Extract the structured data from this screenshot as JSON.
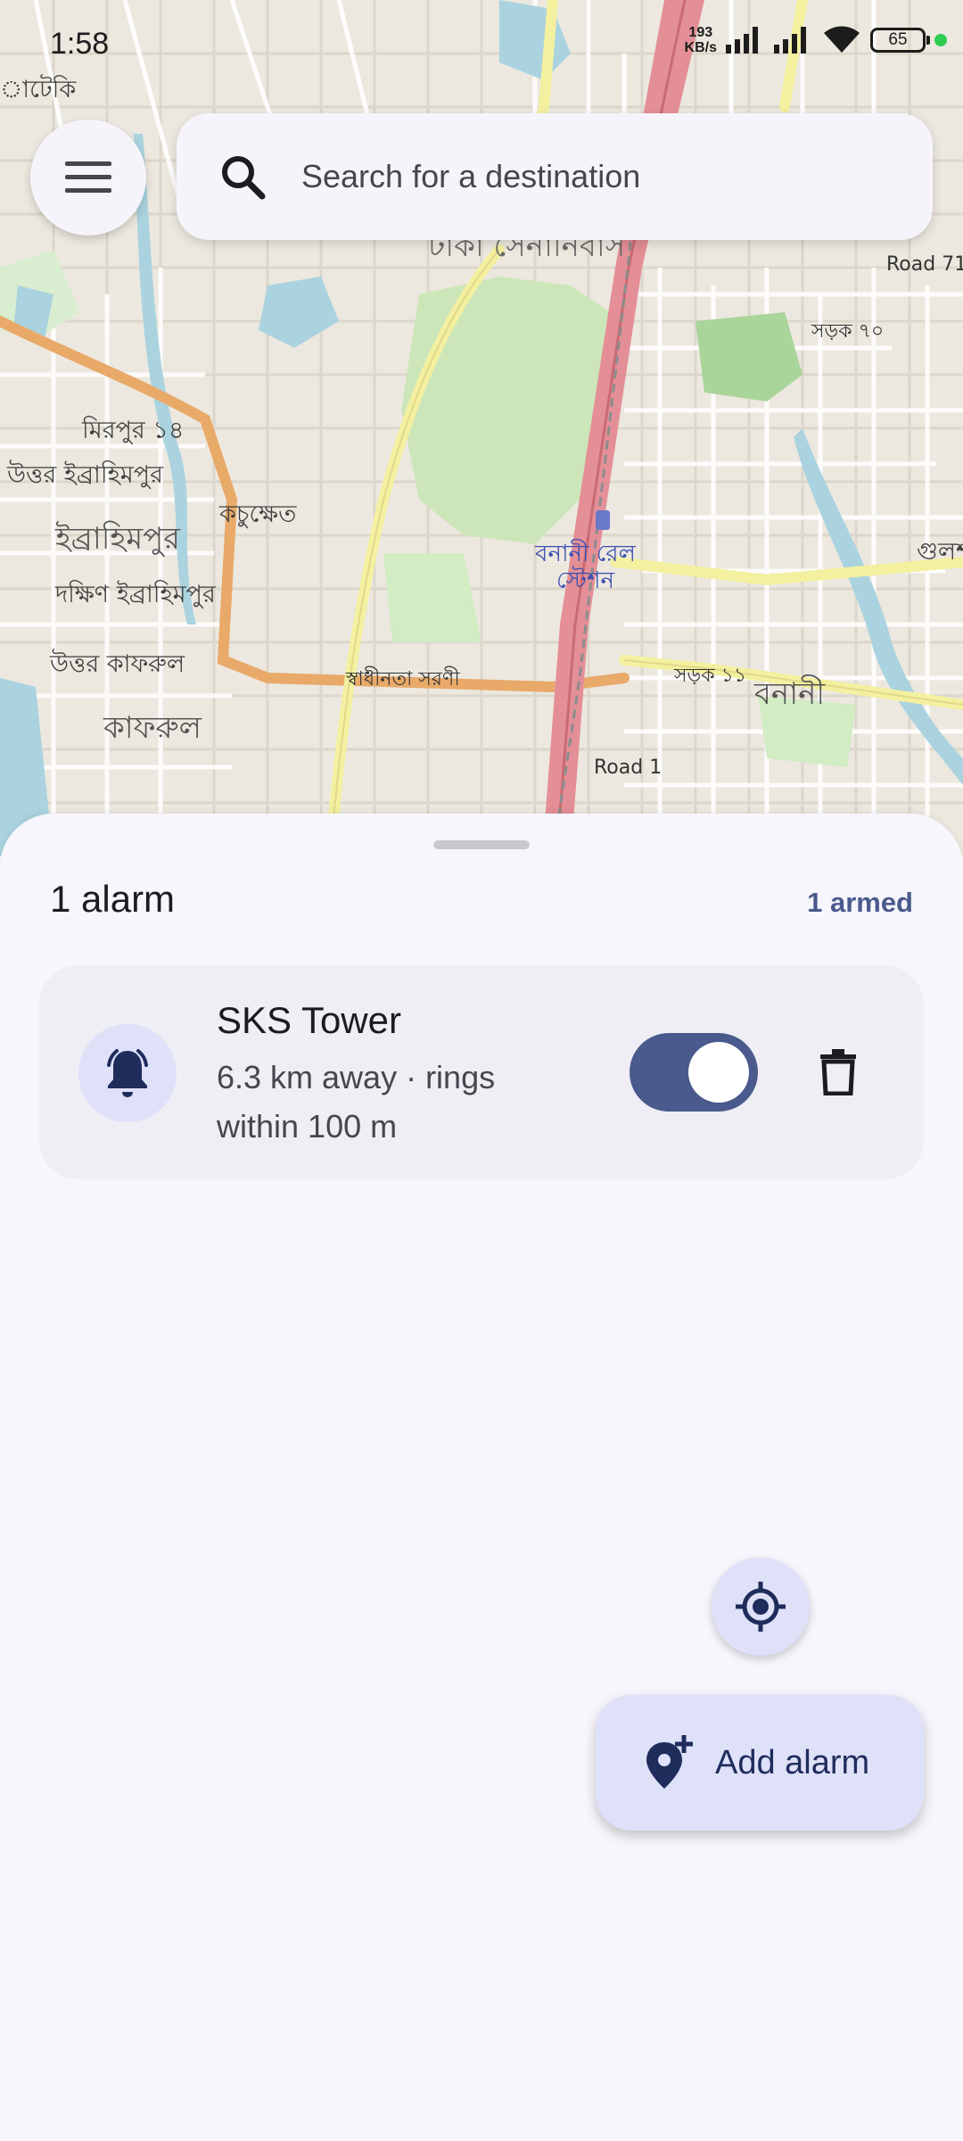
{
  "status_bar": {
    "time": "1:58",
    "net_speed_value": "193",
    "net_speed_unit": "KB/s",
    "battery": "65",
    "icons": [
      "signal-icon",
      "signal-icon",
      "wifi-icon",
      "battery-icon",
      "privacy-dot"
    ]
  },
  "map": {
    "labels": {
      "top_left": "াটেকি",
      "mirpur": "মিরপুর ১৪",
      "uttar_ibrahimpur": "উত্তর ইব্রাহিমপুর",
      "ibrahimpur": "ইব্রাহিমপুর",
      "kachukhet": "কচুক্ষেত",
      "dakkhin_ibrahimpur": "দক্ষিণ ইব্রাহিমপুর",
      "uttar_kafrul": "উত্তর কাফরুল",
      "kafrul": "কাফরুল",
      "banani_station_1": "বনানী রেল",
      "banani_station_2": "স্টেশন",
      "banani": "বনানী",
      "road_71": "Road 71",
      "sarak_70": "সড়ক ৭০",
      "sarak_11": "সড়ক ১১",
      "road_1": "Road 1",
      "gulshan": "গুলশ",
      "swadhinata": "স্বাধীনতা সরণী",
      "dhaka_cantonment": "ঢাকা সেনানিবাস"
    }
  },
  "top": {
    "menu_icon": "menu-icon",
    "search_icon": "search-icon",
    "search_placeholder": "Search for a destination"
  },
  "sheet": {
    "alarm_count": "1 alarm",
    "armed_count": "1 armed",
    "alarms": [
      {
        "name": "SKS Tower",
        "detail": "6.3 km away · rings within 100 m",
        "enabled": true,
        "icon": "bell-icon"
      }
    ]
  },
  "actions": {
    "locate_icon": "my-location-icon",
    "add_alarm_label": "Add alarm",
    "add_alarm_icon": "add-location-icon"
  },
  "colors": {
    "accent": "#4a5a8c",
    "container": "#dfe1f9",
    "surface": "#f7f6fc",
    "card": "#efeef5"
  }
}
